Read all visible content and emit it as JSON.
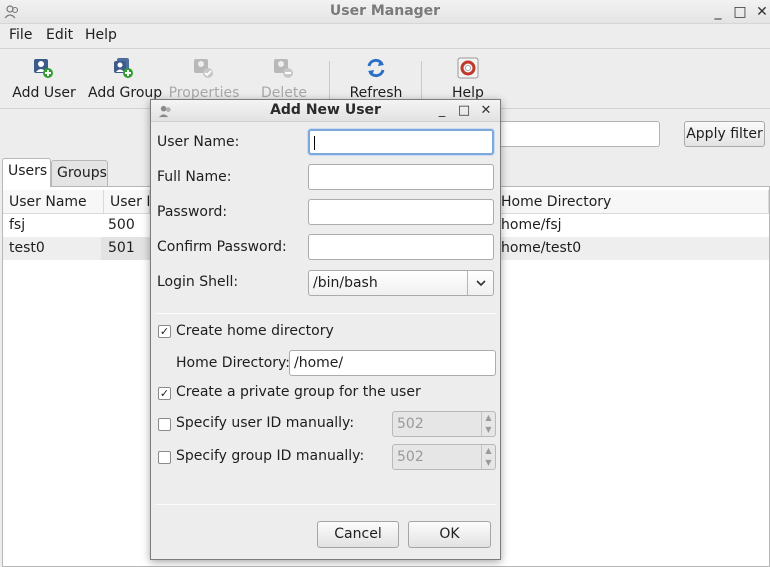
{
  "window": {
    "title": "User Manager",
    "controls": {
      "minimize": "_",
      "maximize": "□",
      "close": "✕"
    }
  },
  "menu": [
    "File",
    "Edit",
    "Help"
  ],
  "toolbar": {
    "add_user": "Add User",
    "add_group": "Add Group",
    "properties": "Properties",
    "delete": "Delete",
    "refresh": "Refresh",
    "help": "Help"
  },
  "filter": {
    "value": "",
    "apply_label": "Apply filter"
  },
  "tabs": [
    {
      "label": "Users",
      "active": true
    },
    {
      "label": "Groups",
      "active": false
    }
  ],
  "users_table": {
    "columns": [
      "User Name",
      "User ID",
      "Home Directory"
    ],
    "rows": [
      {
        "name": "fsj",
        "id": "500",
        "home": "home/fsj"
      },
      {
        "name": "test0",
        "id": "501",
        "home": "home/test0"
      }
    ]
  },
  "dialog": {
    "title": "Add New User",
    "controls": {
      "minimize": "_",
      "maximize": "□",
      "close": "✕"
    },
    "fields": {
      "user_name_label": "User Name:",
      "user_name_value": "",
      "full_name_label": "Full Name:",
      "full_name_value": "",
      "password_label": "Password:",
      "password_value": "",
      "confirm_password_label": "Confirm Password:",
      "confirm_password_value": "",
      "login_shell_label": "Login Shell:",
      "login_shell_value": "/bin/bash"
    },
    "create_home": {
      "label": "Create home directory",
      "checked": true
    },
    "home_dir_label": "Home Directory:",
    "home_dir_value": "/home/",
    "private_group": {
      "label": "Create a private group for the user",
      "checked": true
    },
    "specify_uid": {
      "label": "Specify user ID manually:",
      "checked": false,
      "value": "502"
    },
    "specify_gid": {
      "label": "Specify group ID manually:",
      "checked": false,
      "value": "502"
    },
    "check_mark": "✓",
    "cancel_label": "Cancel",
    "ok_label": "OK"
  },
  "colors": {
    "focus_border": "#7ea7dc",
    "add_badge": "#2f9e2f",
    "refresh_blue": "#2b6fc7",
    "help_red": "#c0392b"
  }
}
